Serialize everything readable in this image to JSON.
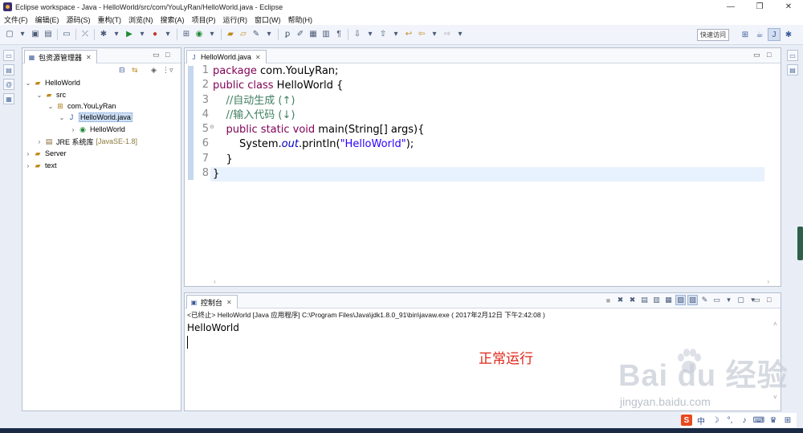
{
  "window": {
    "title": "Eclipse workspace - Java - HelloWorld/src/com/YouLyRan/HelloWorld.java - Eclipse",
    "controls": [
      "—",
      "❐",
      "✕"
    ]
  },
  "menu": [
    "文件(F)",
    "编辑(E)",
    "源码(S)",
    "重构(T)",
    "浏览(N)",
    "搜索(A)",
    "项目(P)",
    "运行(R)",
    "窗口(W)",
    "帮助(H)"
  ],
  "toolbar": {
    "quick_access": "快速访问"
  },
  "explorer": {
    "tab_label": "包资源管理器",
    "tree": [
      {
        "label": "HelloWorld",
        "icon": "project-icon",
        "arrow": "⌄"
      },
      {
        "label": "src",
        "icon": "folder-icon",
        "arrow": "⌄"
      },
      {
        "label": "com.YouLyRan",
        "icon": "package-icon",
        "arrow": "⌄"
      },
      {
        "label": "HelloWorld.java",
        "icon": "java-file-icon",
        "arrow": "⌄"
      },
      {
        "label": "HelloWorld",
        "icon": "class-icon",
        "arrow": "›"
      },
      {
        "label": "JRE 系统库",
        "decor": "[JavaSE-1.8]",
        "icon": "library-icon",
        "arrow": "›"
      },
      {
        "label": "Server",
        "icon": "project-icon",
        "arrow": "›"
      },
      {
        "label": "text",
        "icon": "project-icon",
        "arrow": "›"
      }
    ]
  },
  "editor": {
    "tab_label": "HelloWorld.java",
    "line_numbers": [
      "1",
      "2",
      "3",
      "4",
      "5",
      "6",
      "7",
      "8"
    ],
    "code": {
      "l1_kw": "package",
      "l1_rest": " com.YouLyRan;",
      "l2_kw1": "public",
      "l2_kw2": "class",
      "l2_rest": " HelloWorld {",
      "l3": "    //自动生成 (↑)",
      "l4": "    //输入代码 (↓)",
      "l5_kw1": "public",
      "l5_kw2": "static",
      "l5_kw3": "void",
      "l5_rest": " main(String[] args){",
      "l6_a": "        System.",
      "l6_field": "out",
      "l6_b": ".println(",
      "l6_str": "\"HelloWorld\"",
      "l6_c": ");",
      "l7": "    }",
      "l8": "}"
    }
  },
  "console": {
    "tab_label": "控制台",
    "status": "<已终止> HelloWorld [Java 应用程序] C:\\Program Files\\Java\\jdk1.8.0_91\\bin\\javaw.exe ( 2017年2月12日 下午2:42:08 )",
    "output": "HelloWorld"
  },
  "annotation": "正常运行",
  "watermark": {
    "main": "Bai du 经验",
    "sub": "jingyan.baidu.com"
  },
  "tray": {
    "ime_label": "中"
  },
  "colors": {
    "keyword": "#7f0055",
    "comment": "#3f7f5f",
    "string": "#2a00ff",
    "annotation": "#e0271a"
  }
}
